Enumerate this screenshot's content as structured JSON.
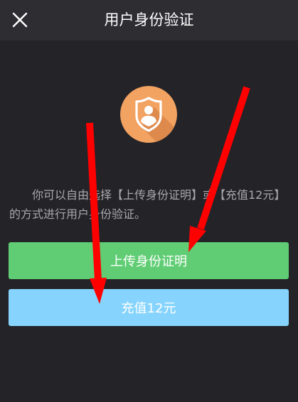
{
  "header": {
    "title": "用户身份验证"
  },
  "icons": {
    "close": "close-icon",
    "badge": "shield-user-icon"
  },
  "content": {
    "description": "你可以自由选择【上传身份证明】或【充值12元】的方式进行用户身份验证。"
  },
  "buttons": {
    "upload_label": "上传身份证明",
    "recharge_label": "充值12元"
  },
  "colors": {
    "background": "#232328",
    "header": "#2d2d32",
    "badge": "#f2a261",
    "upload_button": "#60cd74",
    "recharge_button": "#86d4fd",
    "annotation_arrow": "#ff0000"
  }
}
